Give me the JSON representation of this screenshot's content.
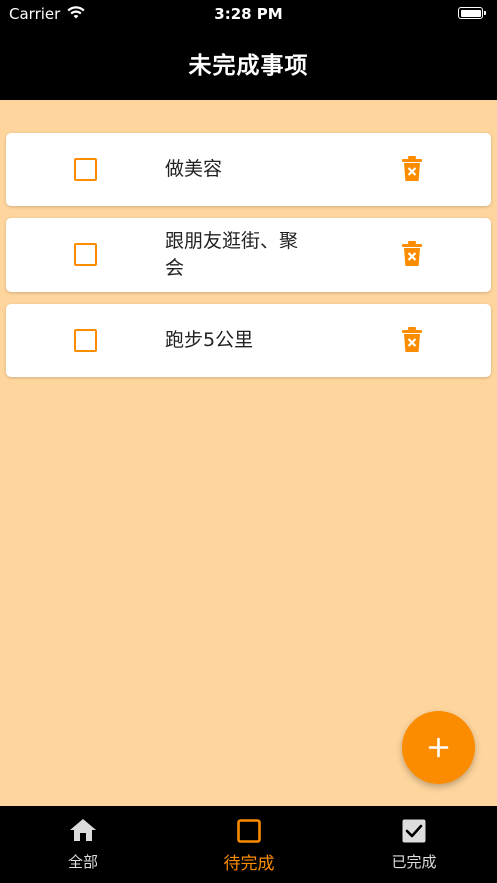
{
  "status_bar": {
    "carrier": "Carrier",
    "time": "3:28 PM"
  },
  "header": {
    "title": "未完成事项"
  },
  "todos": [
    {
      "text": "做美容",
      "checked": false
    },
    {
      "text": "跟朋友逛街、聚会",
      "checked": false
    },
    {
      "text": "跑步5公里",
      "checked": false
    }
  ],
  "fab": {
    "icon": "plus-icon"
  },
  "tabs": [
    {
      "label": "全部",
      "icon": "home-icon",
      "active": false
    },
    {
      "label": "待完成",
      "icon": "checkbox-outline-icon",
      "active": true
    },
    {
      "label": "已完成",
      "icon": "checkbox-checked-icon",
      "active": false
    }
  ],
  "colors": {
    "accent": "#fb8c00",
    "background": "#fed59d",
    "bar": "#000000"
  }
}
